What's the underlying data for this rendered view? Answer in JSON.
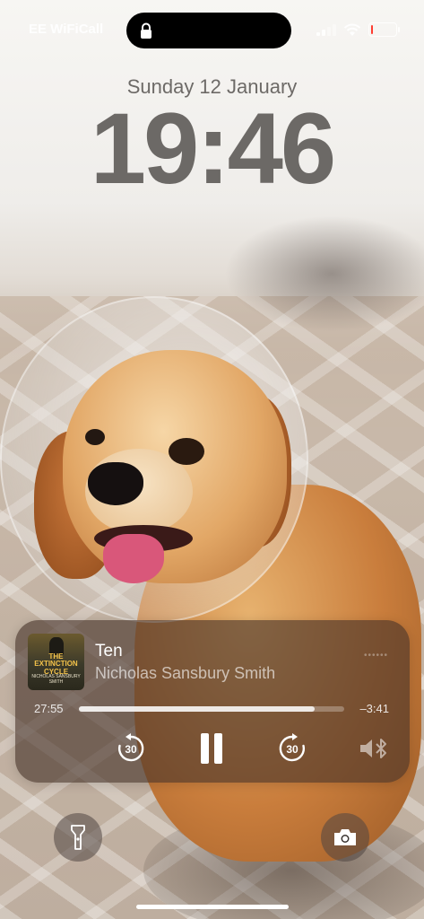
{
  "status_bar": {
    "carrier": "EE WiFiCall",
    "battery_level": 0.1,
    "battery_color": "#ff3b30",
    "icons": [
      "lock-icon",
      "signal-icon",
      "wifi-icon",
      "battery-icon"
    ]
  },
  "lockscreen": {
    "date": "Sunday 12 January",
    "time": "19:46"
  },
  "now_playing": {
    "artwork_title": "THE EXTINCTION CYCLE",
    "artwork_author": "NICHOLAS SANSBURY SMITH",
    "track_title": "Ten",
    "artist": "Nicholas Sansbury Smith",
    "elapsed": "27:55",
    "remaining": "–3:41",
    "progress": 0.89,
    "skip_back_seconds": "30",
    "skip_forward_seconds": "30",
    "controls": [
      "skip-back-30-icon",
      "pause-icon",
      "skip-forward-30-icon",
      "audio-output-icon"
    ]
  },
  "quick_actions": {
    "left": "flashlight-icon",
    "right": "camera-icon"
  }
}
